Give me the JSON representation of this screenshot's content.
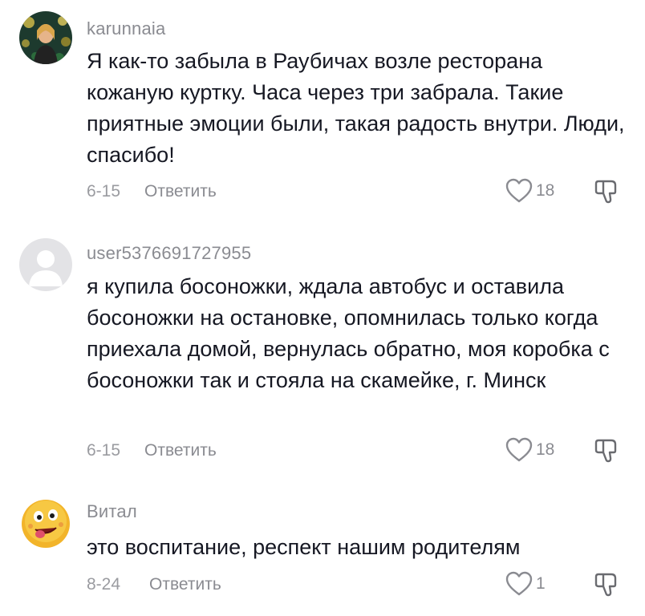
{
  "comments": [
    {
      "username": "karunnaia",
      "text": "Я как-то забыла в Раубичах возле ресторана кожаную куртку. Часа через три забрала. Такие приятные эмоции были, такая радость внутри. Люди, спасибо!",
      "date": "6-15",
      "reply_label": "Ответить",
      "likes": "18",
      "avatar": "photo-avatar"
    },
    {
      "username": "user5376691727955",
      "text": "я купила босоножки, ждала автобус и оставила босоножки на остановке, опомнилась только когда приехала домой, вернулась обратно, моя коробка с босоножки так и стояла на скамейке, г. Минск",
      "date": "6-15",
      "reply_label": "Ответить",
      "likes": "18",
      "avatar": "default-avatar"
    },
    {
      "username": "Витал",
      "text": "это воспитание, респект нашим родителям",
      "date": "8-24",
      "reply_label": "Ответить",
      "likes": "1",
      "avatar": "emoji-avatar"
    }
  ],
  "icons": {
    "like": "heart-outline-icon",
    "dislike": "thumbs-down-outline-icon"
  },
  "colors": {
    "text": "#161823",
    "muted": "#8a8b91"
  }
}
